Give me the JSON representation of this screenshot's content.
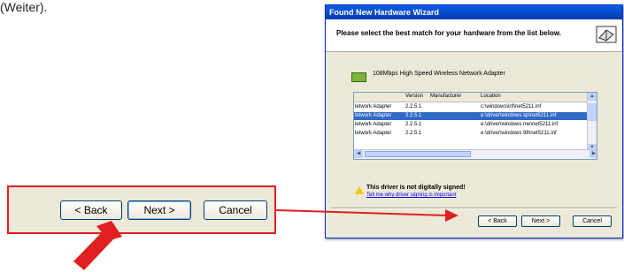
{
  "caption": "(Weiter).",
  "zoom": {
    "back_label": "< Back",
    "next_label": "Next >",
    "cancel_label": "Cancel"
  },
  "wizard": {
    "title": "Found New Hardware Wizard",
    "header": "Please select the best match for your hardware from the list below.",
    "device_name": "108Mbps High Speed Wireless Network Adapter",
    "columns": [
      "Version",
      "Manufacturer",
      "Location"
    ],
    "rows": [
      {
        "name": "letwork Adapter",
        "version": "2.2.5.1",
        "location": "c:\\windows\\inf\\net5211.inf"
      },
      {
        "name": "letwork Adapter",
        "version": "2.2.5.1",
        "location": "e:\\driver\\windows xp\\net5211.inf"
      },
      {
        "name": "letwork Adapter",
        "version": "2.2.5.1",
        "location": "e:\\driver\\windows me\\net5211.inf"
      },
      {
        "name": "letwork Adapter",
        "version": "2.2.5.1",
        "location": "e:\\driver\\windows 98\\net5211.inf"
      }
    ],
    "selected_row": 1,
    "warning": "This driver is not digitally signed!",
    "warning_link": "Tell me why driver signing is important",
    "back_label": "< Back",
    "next_label": "Next >",
    "cancel_label": "Cancel"
  },
  "colors": {
    "callout_red": "#e02020",
    "title_blue": "#0a5fe4",
    "selection_blue": "#316ac5"
  }
}
